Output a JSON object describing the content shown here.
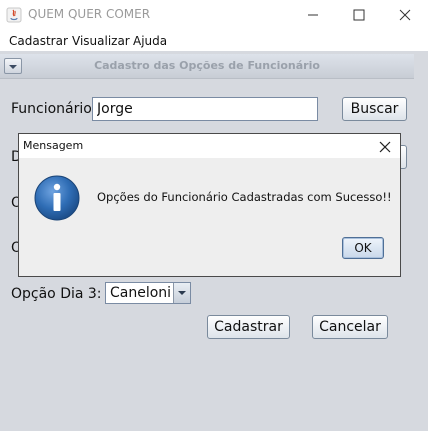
{
  "window": {
    "title": "QUEM QUER COMER",
    "controls": {
      "minimize": "minimize-icon",
      "maximize": "maximize-icon",
      "close": "close-icon"
    }
  },
  "menubar": {
    "items": [
      "Cadastrar",
      "Visualizar",
      "Ajuda"
    ]
  },
  "internal_frame": {
    "title": "Cadastro das Opções de Funcionário"
  },
  "form": {
    "funcionario_label": "Funcionário:",
    "funcionario_value": "Jorge",
    "buscar_label": "Buscar",
    "hidden_label_1": "D",
    "hidden_label_2": "O",
    "hidden_label_3": "O",
    "opcao_dia3_label": "Opção Dia 3:",
    "opcao_dia3_value": "Caneloni",
    "cadastrar_label": "Cadastrar",
    "cancelar_label": "Cancelar"
  },
  "dialog": {
    "title": "Mensagem",
    "message": "Opções do Funcionário Cadastradas com Sucesso!!",
    "ok_label": "OK",
    "icon": "info-icon"
  },
  "colors": {
    "frame_background": "#d6d9df",
    "info_icon_blue": "#2f6db5",
    "title_text_gray": "#9a9a9a"
  }
}
